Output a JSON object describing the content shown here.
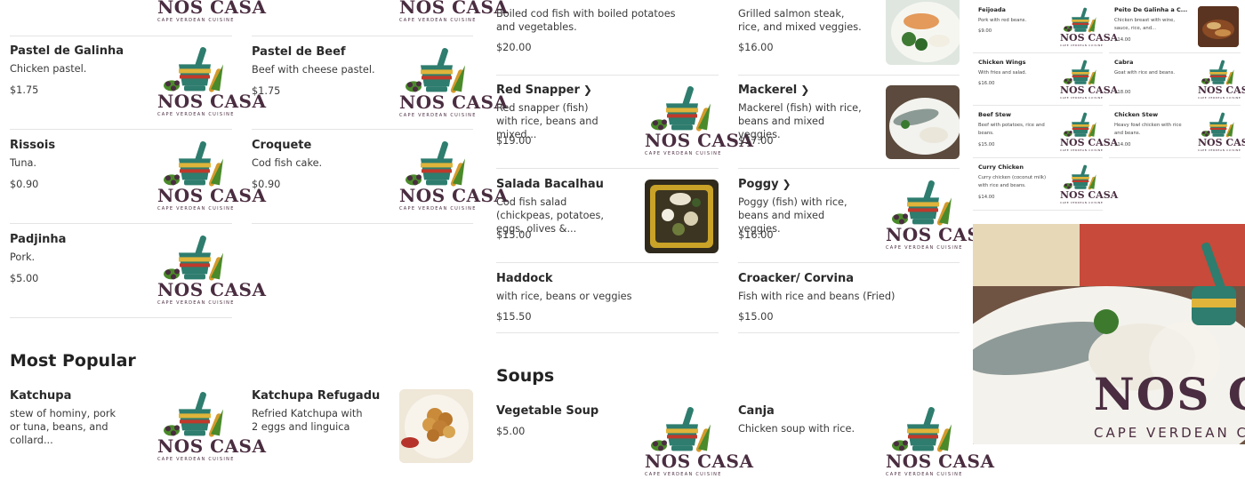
{
  "brand": {
    "logo_word": "NOS CASA",
    "logo_tag": "CAPE VERDEAN CUISINE"
  },
  "colors": {
    "logo_text": "#4a2d40",
    "accent_green": "#4a8a2a",
    "mortar_teal": "#2e7d6e",
    "mortar_red": "#c0392b",
    "mortar_yellow": "#e0b43a"
  },
  "col1": {
    "items": [
      {
        "name": "Pastel de Galinha",
        "desc": "Chicken pastel.",
        "price": "$1.75"
      },
      {
        "name": "Rissois",
        "desc": "Tuna.",
        "price": "$0.90"
      },
      {
        "name": "Padjinha",
        "desc": "Pork.",
        "price": "$5.00"
      }
    ]
  },
  "col2": {
    "items": [
      {
        "name": "Pastel de Beef",
        "desc": "Beef with cheese pastel.",
        "price": "$1.75"
      },
      {
        "name": "Croquete",
        "desc": "Cod fish cake.",
        "price": "$0.90"
      }
    ]
  },
  "popular": {
    "title": "Most Popular",
    "items": [
      {
        "name": "Katchupa",
        "desc": "stew of hominy, pork or tuna, beans, and collard..."
      },
      {
        "name": "Katchupa Refugadu",
        "desc": "Refried Katchupa with 2 eggs and linguica"
      }
    ]
  },
  "col3": {
    "top_desc": "Boiled cod fish with boiled potatoes and vegetables.",
    "top_price": "$20.00",
    "items": [
      {
        "name": "Red Snapper",
        "desc": "Red snapper (fish) with rice, beans and mixed...",
        "price": "$19.00"
      },
      {
        "name": "Salada Bacalhau",
        "desc": "Cod fish salad (chickpeas, potatoes, eggs, olives &...",
        "price": "$15.00"
      },
      {
        "name": "Haddock",
        "desc": "with rice, beans or veggies",
        "price": "$15.50"
      }
    ]
  },
  "col4": {
    "top_desc": "Grilled salmon steak, rice, and mixed veggies.",
    "top_price": "$16.00",
    "items": [
      {
        "name": "Mackerel",
        "desc": "Mackerel (fish) with rice, beans and mixed veggies.",
        "price": "$17.00"
      },
      {
        "name": "Poggy",
        "desc": "Poggy (fish) with rice, beans and mixed veggies.",
        "price": "$16.00"
      },
      {
        "name": "Croacker/ Corvina",
        "desc": "Fish with rice and beans (Fried)",
        "price": "$15.00"
      }
    ]
  },
  "soups": {
    "title": "Soups",
    "items": [
      {
        "name": "Vegetable Soup",
        "price": "$5.00"
      },
      {
        "name": "Canja",
        "desc": "Chicken soup with rice."
      }
    ]
  },
  "mini_left": [
    {
      "name": "Feijoada",
      "desc": "Pork with red beans.",
      "price": "$9.00"
    },
    {
      "name": "Chicken Wings",
      "desc": "With fries and salad.",
      "price": "$16.00"
    },
    {
      "name": "Beef Stew",
      "desc": "Beef with potatoes, rice and beans.",
      "price": "$15.00"
    },
    {
      "name": "Curry Chicken",
      "desc": "Curry chicken (coconut milk) with rice and beans.",
      "price": "$14.00"
    }
  ],
  "mini_right": [
    {
      "name": "Peito De Galinha a C...",
      "desc": "Chicken breast with wine, sauce, rice, and...",
      "price": "$14.00"
    },
    {
      "name": "Cabra",
      "desc": "Goat with rice and beans.",
      "price": "$18.00"
    },
    {
      "name": "Chicken Stew",
      "desc": "Heavy fowl chicken with rice and beans.",
      "price": "$14.00"
    }
  ],
  "hero": {
    "word": "NOS CAS",
    "tag": "CAPE VERDEAN CU"
  }
}
